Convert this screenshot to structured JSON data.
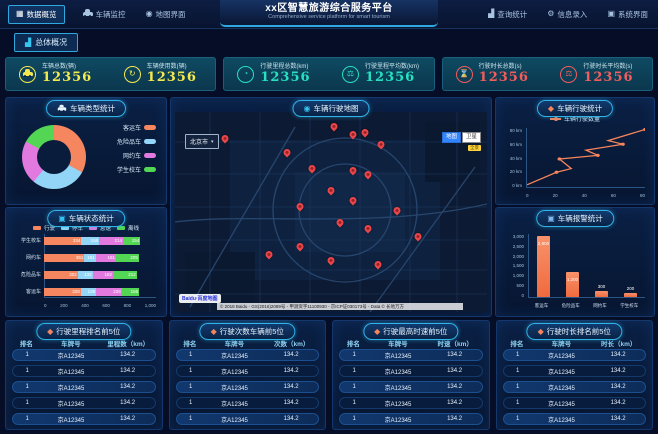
{
  "header": {
    "title": "xx区智慧旅游综合服务平台",
    "subtitle": "Comprehensive service platform for smart tourism",
    "left_menu": [
      {
        "label": "数据概览",
        "icon": "grid-icon",
        "active": true
      },
      {
        "label": "车辆监控",
        "icon": "car-icon",
        "active": false
      },
      {
        "label": "地图界面",
        "icon": "map-pin-icon",
        "active": false
      }
    ],
    "right_menu": [
      {
        "label": "查询统计",
        "icon": "bar-chart-icon",
        "active": false
      },
      {
        "label": "信息录入",
        "icon": "gear-icon",
        "active": false
      },
      {
        "label": "系统界面",
        "icon": "window-icon",
        "active": false
      }
    ]
  },
  "subnav": {
    "tab_label": "总体概况"
  },
  "stats": {
    "groups": [
      {
        "accent": "#f4e94f",
        "cards": [
          {
            "label": "车辆总数(辆)",
            "value": "12356",
            "icon": "car-icon"
          },
          {
            "label": "车辆使用数(辆)",
            "value": "12356",
            "icon": "refresh-icon"
          }
        ]
      },
      {
        "accent": "#28e0c0",
        "cards": [
          {
            "label": "行驶里程总数(km)",
            "value": "12356",
            "icon": "clock-icon"
          },
          {
            "label": "行驶里程平均数(km)",
            "value": "12356",
            "icon": "scale-icon"
          }
        ]
      },
      {
        "accent": "#f25c5c",
        "cards": [
          {
            "label": "行驶时长总数(s)",
            "value": "12356",
            "icon": "hourglass-icon"
          },
          {
            "label": "行驶时长平均数(s)",
            "value": "12356",
            "icon": "scale-icon"
          }
        ]
      }
    ]
  },
  "vehicle_type_panel": {
    "title": "车辆类型统计",
    "chart": {
      "type": "pie",
      "slices": [
        {
          "label": "客运车",
          "value": 33,
          "color": "#f5865f"
        },
        {
          "label": "危险品车",
          "value": 28,
          "color": "#93d5f6"
        },
        {
          "label": "网约车",
          "value": 22,
          "color": "#e179de"
        },
        {
          "label": "学生校车",
          "value": 17,
          "color": "#53d653"
        }
      ]
    }
  },
  "vehicle_status_panel": {
    "title": "车辆状态统计",
    "chart": {
      "type": "stacked-bar-horizontal",
      "legend": [
        {
          "label": "行驶",
          "color": "#f5865f"
        },
        {
          "label": "停车",
          "color": "#93d5f6"
        },
        {
          "label": "怠速",
          "color": "#e179de"
        },
        {
          "label": "离线",
          "color": "#53d653"
        }
      ],
      "categories": [
        "学生校车",
        "网约车",
        "危险品车",
        "客运车"
      ],
      "series": [
        [
          334,
          158,
          214,
          154
        ],
        [
          361,
          101,
          181,
          205
        ],
        [
          302,
          132,
          182,
          212
        ],
        [
          328,
          138,
          228,
          156
        ]
      ],
      "x_ticks": [
        "0",
        "200",
        "400",
        "600",
        "800",
        "1,000"
      ],
      "xmax": 1000
    }
  },
  "map_panel": {
    "title": "车辆行驶地图",
    "city_selector": "北京市",
    "map_type_buttons": [
      "地图",
      "卫星"
    ],
    "panorama_label": "全景",
    "logo_text": "Baidu·百度地图",
    "attribution": "© 2018 Baidu - GS(2016)2089号 - 甲测资字11100930 - 京ICP证030173号 - Data © 长地万方",
    "markers": [
      {
        "x": 16,
        "y": 15
      },
      {
        "x": 51,
        "y": 9
      },
      {
        "x": 57,
        "y": 13
      },
      {
        "x": 61,
        "y": 12
      },
      {
        "x": 66,
        "y": 18
      },
      {
        "x": 36,
        "y": 22
      },
      {
        "x": 44,
        "y": 30
      },
      {
        "x": 57,
        "y": 31
      },
      {
        "x": 62,
        "y": 33
      },
      {
        "x": 50,
        "y": 41
      },
      {
        "x": 57,
        "y": 46
      },
      {
        "x": 40,
        "y": 49
      },
      {
        "x": 53,
        "y": 57
      },
      {
        "x": 62,
        "y": 60
      },
      {
        "x": 71,
        "y": 51
      },
      {
        "x": 78,
        "y": 64
      },
      {
        "x": 40,
        "y": 69
      },
      {
        "x": 30,
        "y": 73
      },
      {
        "x": 50,
        "y": 76
      },
      {
        "x": 65,
        "y": 78
      }
    ]
  },
  "driving_panel": {
    "title": "车辆行驶统计",
    "chart": {
      "type": "line",
      "legend": "车辆行驶数量",
      "color": "#f6845c",
      "y_ticks": [
        "0 km",
        "20 km",
        "40 km",
        "60 km",
        "80 km"
      ],
      "x_ticks": [
        "0",
        "20",
        "40",
        "60",
        "80"
      ],
      "points": [
        [
          0,
          3
        ],
        [
          20,
          20
        ],
        [
          30,
          25
        ],
        [
          22,
          38
        ],
        [
          48,
          43
        ],
        [
          40,
          50
        ],
        [
          65,
          58
        ],
        [
          55,
          63
        ],
        [
          80,
          78
        ]
      ],
      "xmax": 80,
      "ymax": 80
    }
  },
  "alarm_panel": {
    "title": "车辆报警统计",
    "chart": {
      "type": "bar",
      "color": "#f6845c",
      "categories": [
        "客运车",
        "危险品车",
        "网约车",
        "学生校车"
      ],
      "values": [
        2900,
        1200,
        300,
        200
      ],
      "labels": [
        "2,900",
        "1,200",
        "300",
        "200"
      ],
      "y_ticks": [
        "0",
        "500",
        "1,000",
        "1,500",
        "2,000",
        "2,500",
        "3,000"
      ],
      "ymax": 3000
    }
  },
  "tables": [
    {
      "title": "行驶里程排名前5位",
      "columns": [
        "排名",
        "车牌号",
        "里程数（km）"
      ],
      "rows": [
        [
          "1",
          "京A12345",
          "134.2"
        ],
        [
          "1",
          "京A12345",
          "134.2"
        ],
        [
          "1",
          "京A12345",
          "134.2"
        ],
        [
          "1",
          "京A12345",
          "134.2"
        ],
        [
          "1",
          "京A12345",
          "134.2"
        ]
      ]
    },
    {
      "title": "行驶次数车辆前5位",
      "columns": [
        "排名",
        "车牌号",
        "次数（km）"
      ],
      "rows": [
        [
          "1",
          "京A12345",
          "134.2"
        ],
        [
          "1",
          "京A12345",
          "134.2"
        ],
        [
          "1",
          "京A12345",
          "134.2"
        ],
        [
          "1",
          "京A12345",
          "134.2"
        ],
        [
          "1",
          "京A12345",
          "134.2"
        ]
      ]
    },
    {
      "title": "行驶最高时速前5位",
      "columns": [
        "排名",
        "车牌号",
        "时速（km）"
      ],
      "rows": [
        [
          "1",
          "京A12345",
          "134.2"
        ],
        [
          "1",
          "京A12345",
          "134.2"
        ],
        [
          "1",
          "京A12345",
          "134.2"
        ],
        [
          "1",
          "京A12345",
          "134.2"
        ],
        [
          "1",
          "京A12345",
          "134.2"
        ]
      ]
    },
    {
      "title": "行驶时长排名前5位",
      "columns": [
        "排名",
        "车牌号",
        "时长（km）"
      ],
      "rows": [
        [
          "1",
          "京A12345",
          "134.2"
        ],
        [
          "1",
          "京A12345",
          "134.2"
        ],
        [
          "1",
          "京A12345",
          "134.2"
        ],
        [
          "1",
          "京A12345",
          "134.2"
        ],
        [
          "1",
          "京A12345",
          "134.2"
        ]
      ]
    }
  ]
}
